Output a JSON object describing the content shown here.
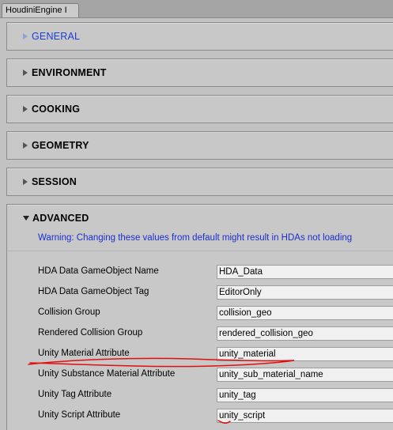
{
  "tab": {
    "title": "HoudiniEngine I"
  },
  "sections": [
    {
      "title": "GENERAL",
      "expanded": false,
      "highlighted": true
    },
    {
      "title": "ENVIRONMENT",
      "expanded": false
    },
    {
      "title": "COOKING",
      "expanded": false
    },
    {
      "title": "GEOMETRY",
      "expanded": false
    },
    {
      "title": "SESSION",
      "expanded": false
    },
    {
      "title": "ADVANCED",
      "expanded": true
    }
  ],
  "advanced": {
    "warning": "Warning: Changing these values from default might result in HDAs not loading",
    "fields": [
      {
        "label": "HDA Data GameObject Name",
        "value": "HDA_Data"
      },
      {
        "label": "HDA Data GameObject Tag",
        "value": "EditorOnly"
      },
      {
        "label": "Collision Group",
        "value": "collision_geo"
      },
      {
        "label": "Rendered Collision Group",
        "value": "rendered_collision_geo"
      },
      {
        "label": "Unity Material Attribute",
        "value": "unity_material"
      },
      {
        "label": "Unity Substance Material Attribute",
        "value": "unity_sub_material_name"
      },
      {
        "label": "Unity Tag Attribute",
        "value": "unity_tag"
      },
      {
        "label": "Unity Script Attribute",
        "value": "unity_script"
      }
    ]
  },
  "colors": {
    "background": "#c2c2c2",
    "highlight_text": "#1a3fd6",
    "warning_text": "#1a2fd0",
    "annotation_stroke": "#e01010"
  }
}
